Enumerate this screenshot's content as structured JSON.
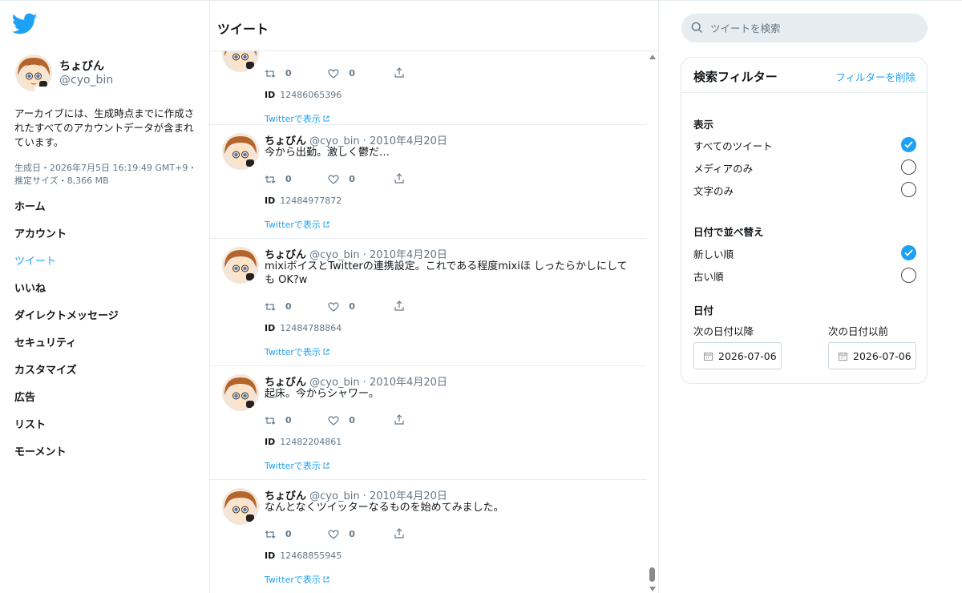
{
  "header": {
    "title": "ツイート"
  },
  "profile": {
    "name": "ちょびん",
    "handle": "@cyo_bin",
    "archive_description": "アーカイブには、生成時点までに作成されたすべてのアカウントデータが含まれています。",
    "generated": "生成日・2026年7月5日 16:19:49 GMT+9・推定サイズ・8,366 MB"
  },
  "nav": [
    {
      "label": "ホーム",
      "active": false
    },
    {
      "label": "アカウント",
      "active": false
    },
    {
      "label": "ツイート",
      "active": true
    },
    {
      "label": "いいね",
      "active": false
    },
    {
      "label": "ダイレクトメッセージ",
      "active": false
    },
    {
      "label": "セキュリティ",
      "active": false
    },
    {
      "label": "カスタマイズ",
      "active": false
    },
    {
      "label": "広告",
      "active": false
    },
    {
      "label": "リスト",
      "active": false
    },
    {
      "label": "モーメント",
      "active": false
    }
  ],
  "tweets": [
    {
      "name": "",
      "handle": "",
      "date": "",
      "text": "",
      "retweets": "0",
      "likes": "0",
      "id_label": "ID",
      "id": "12486065396",
      "link": "Twitterで表示"
    },
    {
      "name": "ちょびん",
      "handle": "@cyo_bin",
      "date": "· 2010年4月20日",
      "text": "今から出勤。激しく鬱だ…",
      "retweets": "0",
      "likes": "0",
      "id_label": "ID",
      "id": "12484977872",
      "link": "Twitterで表示"
    },
    {
      "name": "ちょびん",
      "handle": "@cyo_bin",
      "date": "· 2010年4月20日",
      "text": "mixiボイスとTwitterの連携設定。これである程度mixiほ しったらかしにしても OK?w",
      "retweets": "0",
      "likes": "0",
      "id_label": "ID",
      "id": "12484788864",
      "link": "Twitterで表示"
    },
    {
      "name": "ちょびん",
      "handle": "@cyo_bin",
      "date": "· 2010年4月20日",
      "text": "起床。今からシャワー。",
      "retweets": "0",
      "likes": "0",
      "id_label": "ID",
      "id": "12482204861",
      "link": "Twitterで表示"
    },
    {
      "name": "ちょびん",
      "handle": "@cyo_bin",
      "date": "· 2010年4月20日",
      "text": "なんとなくツイッターなるものを始めてみました。",
      "retweets": "0",
      "likes": "0",
      "id_label": "ID",
      "id": "12468855945",
      "link": "Twitterで表示"
    }
  ],
  "search": {
    "placeholder": "ツイートを検索"
  },
  "filter": {
    "title": "検索フィルター",
    "clear_label": "フィルターを削除",
    "display": {
      "title": "表示",
      "options": [
        {
          "label": "すべてのツイート",
          "selected": true
        },
        {
          "label": "メディアのみ",
          "selected": false
        },
        {
          "label": "文字のみ",
          "selected": false
        }
      ]
    },
    "sort": {
      "title": "日付で並べ替え",
      "options": [
        {
          "label": "新しい順",
          "selected": true
        },
        {
          "label": "古い順",
          "selected": false
        }
      ]
    },
    "date": {
      "title": "日付",
      "after_label": "次の日付以降",
      "before_label": "次の日付以前",
      "after_value": "2026-07-06",
      "before_value": "2026-07-06"
    }
  },
  "colors": {
    "accent": "#1da1f2",
    "muted": "#657786",
    "border": "#e6ecf0"
  }
}
